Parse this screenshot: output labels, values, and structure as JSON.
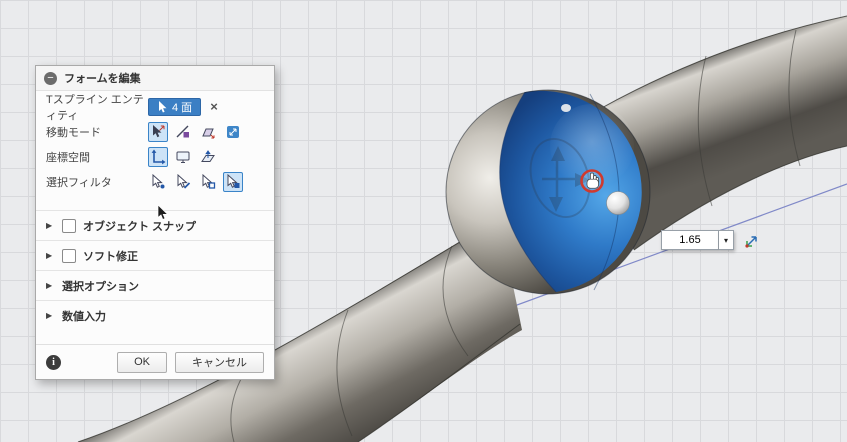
{
  "colors": {
    "accent_blue": "#3a84c8",
    "selection_chip_blue": "#3b7fc4",
    "selected_face_blue": "#2f7ac8",
    "highlight_red": "#cf3a2f",
    "grid_line": "#d8d9dc",
    "viewport_background": "#eaebed"
  },
  "dialog": {
    "title": "フォームを編集",
    "collapse_glyph": "−",
    "entity_row": {
      "label": "Tスプライン エンティティ",
      "selection_count": "4 面",
      "clear_glyph": "×"
    },
    "move_mode_label": "移動モード",
    "coord_space_label": "座標空間",
    "selection_filter_label": "選択フィルタ",
    "expand_glyph": "▶",
    "sections": {
      "object_snap": "オブジェクト スナップ",
      "soft_edit": "ソフト修正",
      "selection_options": "選択オプション",
      "numeric_input": "数値入力"
    },
    "footer": {
      "info_glyph": "i",
      "ok": "OK",
      "cancel": "キャンセル"
    }
  },
  "viewport": {
    "distance_field": {
      "value": "1.65",
      "dropdown_glyph": "▾"
    }
  }
}
